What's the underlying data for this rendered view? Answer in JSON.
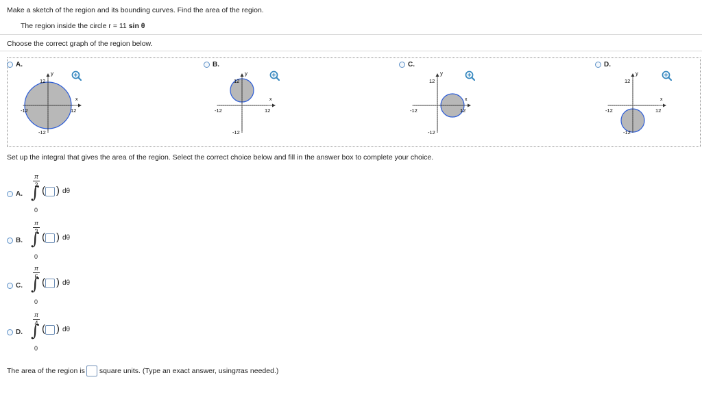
{
  "question": {
    "instruction": "Make a sketch of the region and its bounding curves. Find the area of the region.",
    "region_prefix": "The region inside the circle r",
    "region_eq": " = 11 ",
    "region_func": "sin θ"
  },
  "graph_section": {
    "prompt": "Choose the correct graph of the region below.",
    "options": [
      {
        "letter": "A.",
        "y_label": "y",
        "x_label": "x",
        "tick_pos": "12",
        "tick_neg": "-12",
        "shading": "large circle centered at origin"
      },
      {
        "letter": "B.",
        "y_label": "y",
        "x_label": "x",
        "tick_pos": "12",
        "tick_neg": "-12",
        "shading": "circle above x-axis"
      },
      {
        "letter": "C.",
        "y_label": "y",
        "x_label": "x",
        "tick_pos": "12",
        "tick_neg": "-12",
        "shading": "circle right of y-axis"
      },
      {
        "letter": "D.",
        "y_label": "y",
        "x_label": "x",
        "tick_pos": "12",
        "tick_neg": "-12",
        "shading": "circle below x-axis"
      }
    ],
    "zoom_icon": "magnify-plus-icon",
    "accent_color": "#3a8ac0",
    "region_fill": "#b8b8b8",
    "circle_stroke": "#2a5bd7"
  },
  "integral_section": {
    "prompt": "Set up the integral that gives the area of the region. Select the correct choice below and fill in the answer box to complete your choice.",
    "options": [
      {
        "letter": "A.",
        "upper_num": "π",
        "upper_den": "2",
        "lower": "0",
        "differential": "dθ"
      },
      {
        "letter": "B.",
        "upper_num": "π",
        "upper_den": "3",
        "lower": "0",
        "differential": "dθ"
      },
      {
        "letter": "C.",
        "upper_num": "π",
        "upper_den": "6",
        "lower": "0",
        "differential": "dθ"
      },
      {
        "letter": "D.",
        "upper_num": "π",
        "upper_den": "4",
        "lower": "0",
        "differential": "dθ"
      }
    ]
  },
  "area": {
    "prefix": "The area of the region is",
    "suffix_start": "square units. (Type an exact answer, using ",
    "pi": "π",
    "suffix_end": " as needed.)"
  }
}
